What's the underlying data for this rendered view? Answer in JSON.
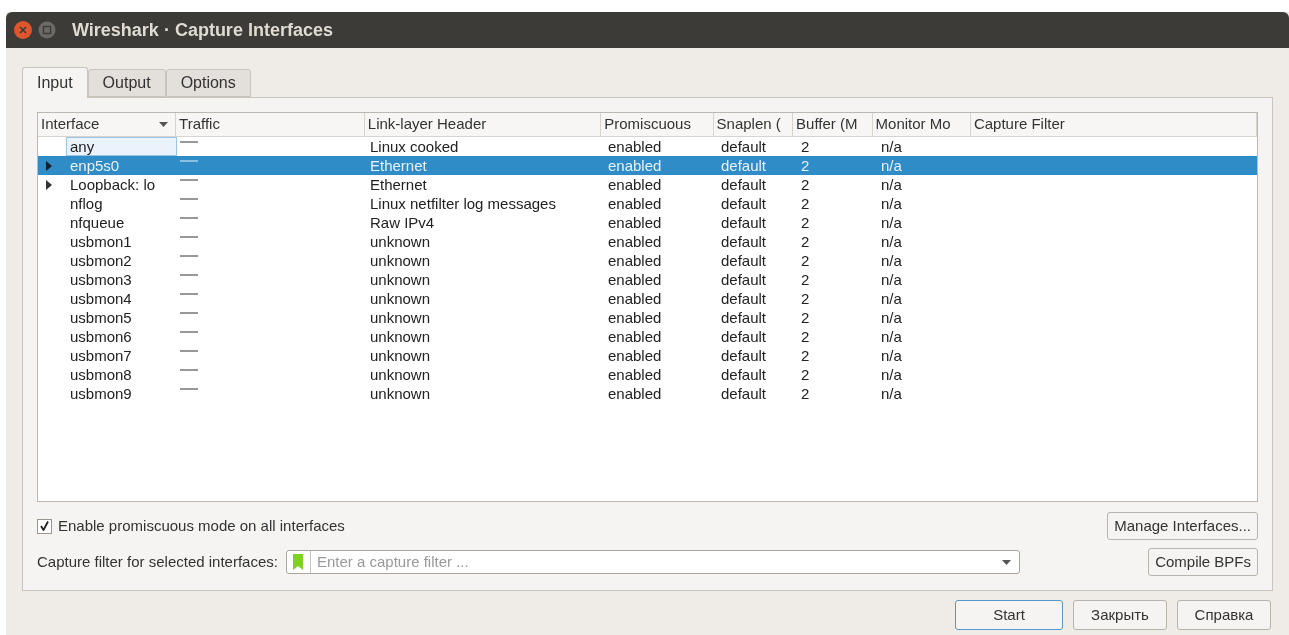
{
  "window": {
    "title": "Wireshark · Capture Interfaces"
  },
  "tabs": [
    {
      "label": "Input",
      "selected": true
    },
    {
      "label": "Output",
      "selected": false
    },
    {
      "label": "Options",
      "selected": false
    }
  ],
  "table": {
    "columns": [
      {
        "label": "Interface",
        "sorted": true
      },
      {
        "label": "Traffic",
        "sorted": false
      },
      {
        "label": "Link-layer Header",
        "sorted": false
      },
      {
        "label": "Promiscuous",
        "sorted": false
      },
      {
        "label": "Snaplen (",
        "sorted": false
      },
      {
        "label": "Buffer (M",
        "sorted": false
      },
      {
        "label": "Monitor Mo",
        "sorted": false
      },
      {
        "label": "Capture Filter",
        "sorted": false
      }
    ],
    "rows": [
      {
        "interface": "any",
        "expandable": false,
        "focused": true,
        "selected": false,
        "link": "Linux cooked",
        "promiscuous": "enabled",
        "snaplen": "default",
        "buffer": "2",
        "monitor": "n/a"
      },
      {
        "interface": "enp5s0",
        "expandable": true,
        "focused": false,
        "selected": true,
        "link": "Ethernet",
        "promiscuous": "enabled",
        "snaplen": "default",
        "buffer": "2",
        "monitor": "n/a"
      },
      {
        "interface": "Loopback: lo",
        "expandable": true,
        "focused": false,
        "selected": false,
        "link": "Ethernet",
        "promiscuous": "enabled",
        "snaplen": "default",
        "buffer": "2",
        "monitor": "n/a"
      },
      {
        "interface": "nflog",
        "expandable": false,
        "focused": false,
        "selected": false,
        "link": "Linux netfilter log messages",
        "promiscuous": "enabled",
        "snaplen": "default",
        "buffer": "2",
        "monitor": "n/a"
      },
      {
        "interface": "nfqueue",
        "expandable": false,
        "focused": false,
        "selected": false,
        "link": "Raw IPv4",
        "promiscuous": "enabled",
        "snaplen": "default",
        "buffer": "2",
        "monitor": "n/a"
      },
      {
        "interface": "usbmon1",
        "expandable": false,
        "focused": false,
        "selected": false,
        "link": "unknown",
        "promiscuous": "enabled",
        "snaplen": "default",
        "buffer": "2",
        "monitor": "n/a"
      },
      {
        "interface": "usbmon2",
        "expandable": false,
        "focused": false,
        "selected": false,
        "link": "unknown",
        "promiscuous": "enabled",
        "snaplen": "default",
        "buffer": "2",
        "monitor": "n/a"
      },
      {
        "interface": "usbmon3",
        "expandable": false,
        "focused": false,
        "selected": false,
        "link": "unknown",
        "promiscuous": "enabled",
        "snaplen": "default",
        "buffer": "2",
        "monitor": "n/a"
      },
      {
        "interface": "usbmon4",
        "expandable": false,
        "focused": false,
        "selected": false,
        "link": "unknown",
        "promiscuous": "enabled",
        "snaplen": "default",
        "buffer": "2",
        "monitor": "n/a"
      },
      {
        "interface": "usbmon5",
        "expandable": false,
        "focused": false,
        "selected": false,
        "link": "unknown",
        "promiscuous": "enabled",
        "snaplen": "default",
        "buffer": "2",
        "monitor": "n/a"
      },
      {
        "interface": "usbmon6",
        "expandable": false,
        "focused": false,
        "selected": false,
        "link": "unknown",
        "promiscuous": "enabled",
        "snaplen": "default",
        "buffer": "2",
        "monitor": "n/a"
      },
      {
        "interface": "usbmon7",
        "expandable": false,
        "focused": false,
        "selected": false,
        "link": "unknown",
        "promiscuous": "enabled",
        "snaplen": "default",
        "buffer": "2",
        "monitor": "n/a"
      },
      {
        "interface": "usbmon8",
        "expandable": false,
        "focused": false,
        "selected": false,
        "link": "unknown",
        "promiscuous": "enabled",
        "snaplen": "default",
        "buffer": "2",
        "monitor": "n/a"
      },
      {
        "interface": "usbmon9",
        "expandable": false,
        "focused": false,
        "selected": false,
        "link": "unknown",
        "promiscuous": "enabled",
        "snaplen": "default",
        "buffer": "2",
        "monitor": "n/a"
      }
    ]
  },
  "promiscuous_all": {
    "label": "Enable promiscuous mode on all interfaces",
    "checked": true
  },
  "manage_button": "Manage Interfaces...",
  "capture_filter": {
    "label": "Capture filter for selected interfaces:",
    "placeholder": "Enter a capture filter ..."
  },
  "compile_button": "Compile BPFs",
  "buttons": [
    {
      "label": "Start",
      "default": true
    },
    {
      "label": "Закрыть",
      "default": false
    },
    {
      "label": "Справка",
      "default": false
    }
  ]
}
